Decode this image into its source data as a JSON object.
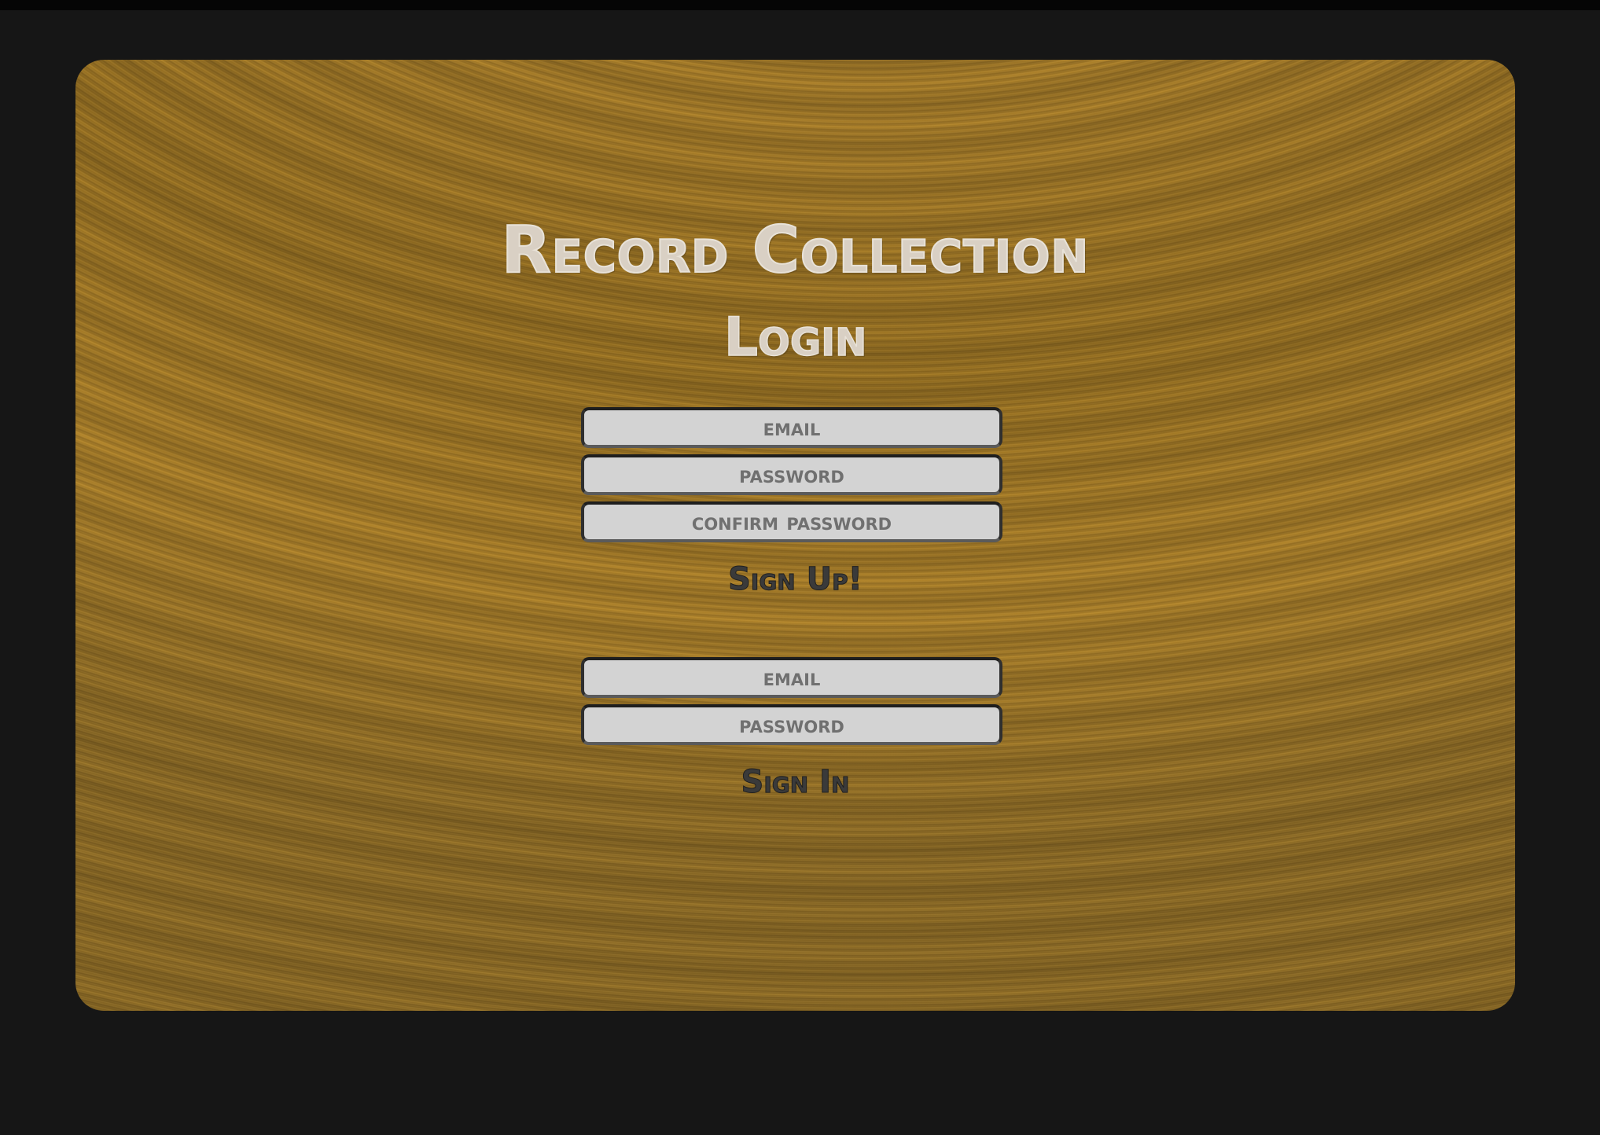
{
  "app": {
    "title": "Record Collection",
    "subtitle": "Login"
  },
  "signup": {
    "email_placeholder": "email",
    "password_placeholder": "password",
    "confirm_placeholder": "confirm password",
    "submit_label": "Sign Up!"
  },
  "signin": {
    "email_placeholder": "email",
    "password_placeholder": "password",
    "submit_label": "Sign In"
  },
  "colors": {
    "page_background": "#161616",
    "panel_wood": "#a97d27",
    "title_text": "#d9d0c4",
    "field_background": "#d3d3d3",
    "field_text": "#6d6d6d",
    "button_text": "#3a3a3a"
  }
}
